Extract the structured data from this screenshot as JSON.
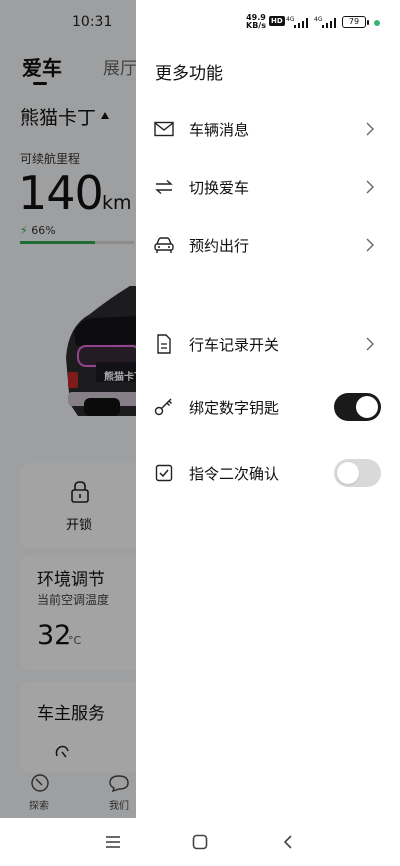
{
  "status_bar": {
    "time": "10:31",
    "speed_value": "49.9",
    "speed_unit": "KB/s",
    "hd": "HD",
    "network_1": "4G",
    "network_2": "4G",
    "battery": "79"
  },
  "background": {
    "tabs": [
      "爱车",
      "展厅"
    ],
    "car_name": "熊猫卡丁",
    "range_label": "可续航里程",
    "range_value": "140",
    "range_unit": "km",
    "battery_percent": "66%",
    "battery_level": 0.66,
    "plate_text": "熊猫卡丁",
    "lock_label": "开锁",
    "env_title": "环境调节",
    "env_subtitle": "当前空调温度",
    "temperature": "32",
    "temperature_unit": "°C",
    "owner_service_title": "车主服务",
    "bottom_nav": [
      "探索",
      "我们"
    ]
  },
  "drawer": {
    "title": "更多功能",
    "items": [
      {
        "label": "车辆消息",
        "icon": "mail-icon",
        "control": "chevron"
      },
      {
        "label": "切换爱车",
        "icon": "swap-arrows-icon",
        "control": "chevron"
      },
      {
        "label": "预约出行",
        "icon": "car-icon",
        "control": "chevron"
      },
      {
        "label": "行车记录开关",
        "icon": "document-icon",
        "control": "chevron"
      },
      {
        "label": "绑定数字钥匙",
        "icon": "key-icon",
        "control": "toggle",
        "on": true
      },
      {
        "label": "指令二次确认",
        "icon": "checkbox-icon",
        "control": "toggle",
        "on": false
      }
    ]
  },
  "colors": {
    "accent_green": "#2fa84f",
    "toggle_on": "#1a1a1a",
    "toggle_off": "#d9d9d9"
  },
  "system_nav": [
    "menu-icon",
    "home-icon",
    "back-icon"
  ]
}
